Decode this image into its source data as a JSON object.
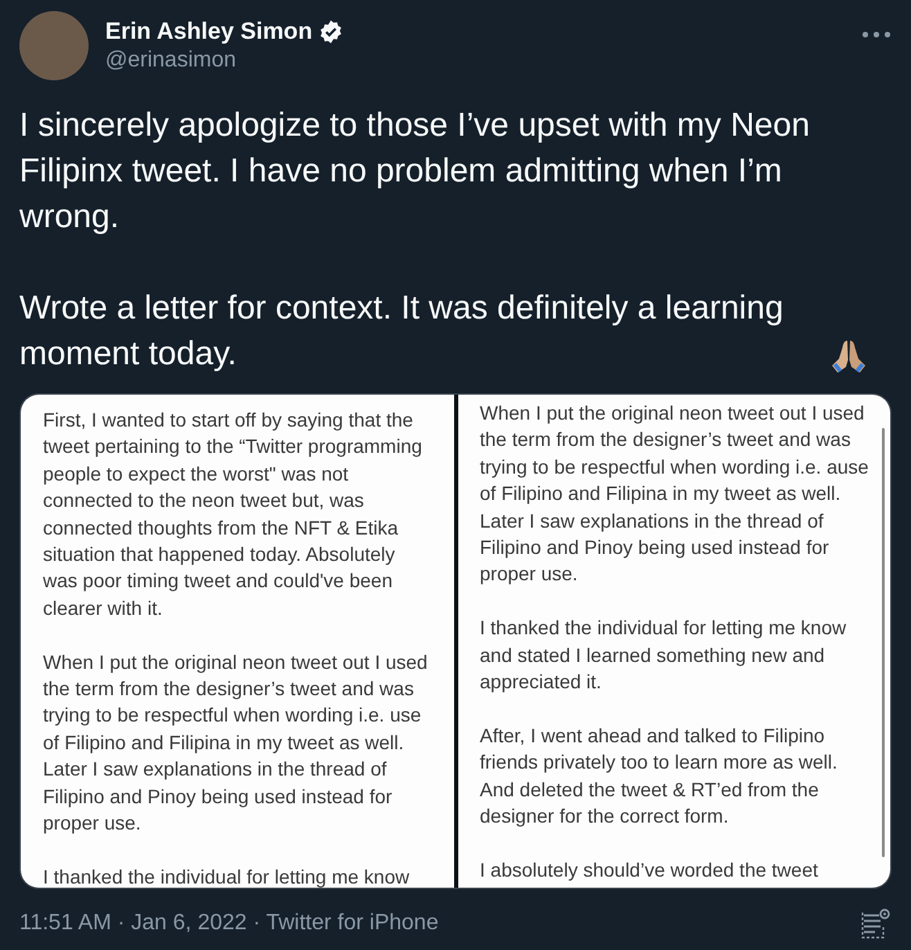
{
  "author": {
    "name": "Erin Ashley Simon",
    "handle": "@erinasimon",
    "verified": true
  },
  "tweet": {
    "paragraphs": [
      "I sincerely apologize to those I’ve upset with my Neon Filipinx tweet. I have no problem admitting when I’m wrong.",
      "Wrote a letter for context. It was definitely a learning moment today."
    ]
  },
  "images": [
    {
      "paragraphs": [
        "First, I wanted to start off by saying that the tweet pertaining to the “Twitter programming people to expect the worst\" was not connected to the neon tweet but, was connected thoughts from the NFT & Etika situation that happened today. Absolutely was poor timing tweet and could've been clearer with it.",
        "When I put the original neon tweet out I used the term from the designer’s tweet and was trying to be respectful when wording i.e. use of Filipino and Filipina in my tweet as well. Later I saw explanations in the thread of Filipino and Pinoy being used instead for proper use.",
        "I thanked the individual for letting me know"
      ]
    },
    {
      "paragraphs": [
        "When I put the original neon tweet out I used the term from the designer’s tweet and was trying to be respectful when wording i.e. ause of Filipino and Filipina in my tweet as well. Later I saw explanations in the thread of Filipino and Pinoy being used instead for proper use.",
        "I thanked the individual for letting me know and stated I learned something new and appreciated it.",
        "After, I went ahead and talked to Filipino friends privately too to learn more as well. And deleted the tweet & RT’ed from the designer for the correct form.",
        "I absolutely should’ve worded the tweet"
      ]
    }
  ],
  "footer": {
    "time": "11:51 AM",
    "separator": "·",
    "date": "Jan 6, 2022",
    "source": "Twitter for iPhone"
  }
}
